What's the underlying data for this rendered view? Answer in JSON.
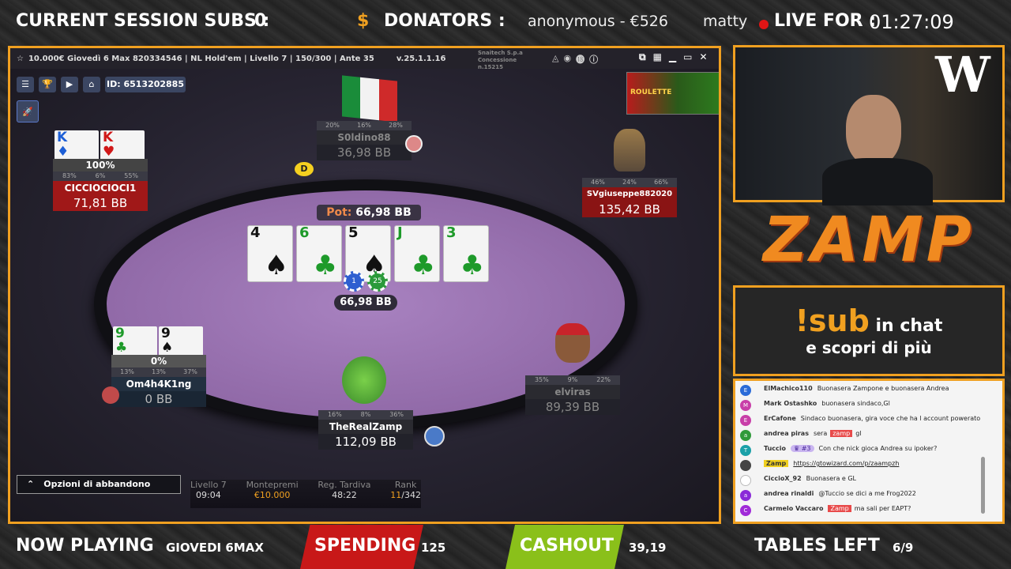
{
  "header": {
    "subs_label": "CURRENT SESSION SUBS :",
    "subs_value": "0",
    "dollar": "$",
    "donators_label": "DONATORS :",
    "donator1": "anonymous - €526",
    "donator2": "matty",
    "live_label": "LIVE FOR :",
    "live_time": "01:27:09"
  },
  "client": {
    "title": "10.000€ Giovedì 6 Max 820334546 | NL Hold'em | Livello 7 | 150/300 | Ante 35",
    "version": "v.25.1.1.16",
    "vendor1": "Snaitech S.p.a",
    "vendor2": "Concessione n.15215",
    "table_id": "ID: 6513202885",
    "pot_label": "Pot:",
    "pot_value": "66,98 BB",
    "center_pot": "66,98 BB",
    "dealer": "D",
    "leave_label": "Opzioni di abbandono",
    "banner": "ROULETTE"
  },
  "board": [
    {
      "r": "4",
      "s": "♠",
      "c": "#111"
    },
    {
      "r": "6",
      "s": "♣",
      "c": "#1e9a2a"
    },
    {
      "r": "5",
      "s": "♠",
      "c": "#111"
    },
    {
      "r": "J",
      "s": "♣",
      "c": "#1e9a2a"
    },
    {
      "r": "3",
      "s": "♣",
      "c": "#1e9a2a"
    }
  ],
  "chips": {
    "a": "1",
    "b": "25"
  },
  "seats": {
    "s1": {
      "name": "S0ldino88",
      "bb": "36,98 BB",
      "stats": [
        "20%",
        "16%",
        "28%"
      ]
    },
    "s2": {
      "name": "SVgiuseppe882020",
      "bb": "135,42 BB",
      "stats": [
        "46%",
        "24%",
        "66%"
      ]
    },
    "s3": {
      "name": "CICCIOCIOCI1",
      "bb": "71,81 BB",
      "stats": [
        "83%",
        "6%",
        "55%"
      ],
      "equity": "100%",
      "cards": [
        {
          "r": "K",
          "s": "♦",
          "c": "#1d5fd6"
        },
        {
          "r": "K",
          "s": "♥",
          "c": "#d01818"
        }
      ]
    },
    "s4": {
      "name": "Om4h4K1ng",
      "bb": "0 BB",
      "stats": [
        "13%",
        "13%",
        "37%"
      ],
      "equity": "0%",
      "cards": [
        {
          "r": "9",
          "s": "♣",
          "c": "#1e9a2a"
        },
        {
          "r": "9",
          "s": "♠",
          "c": "#111"
        }
      ]
    },
    "s5": {
      "name": "TheRealZamp",
      "bb": "112,09 BB",
      "stats": [
        "16%",
        "8%",
        "36%"
      ]
    },
    "s6": {
      "name": "elviras",
      "bb": "89,39 BB",
      "stats": [
        "35%",
        "9%",
        "22%"
      ]
    }
  },
  "tourney": {
    "level_label": "Livello 7",
    "level_time": "09:04",
    "prize_label": "Montepremi",
    "prize": "€10.000",
    "late_label": "Reg. Tardiva",
    "late": "48:22",
    "rank_label": "Rank",
    "rank_cur": "11",
    "rank_tot": "/342"
  },
  "brand": {
    "logo": "W",
    "name": "ZAMP",
    "sub_cmd": "!sub",
    "sub_text": " in chat",
    "sub_line2": "e scopri di più"
  },
  "chat": [
    {
      "av": "E",
      "col": "#2a6bd8",
      "user": "ElMachico110",
      "msg": "Buonasera Zampone e buonasera Andrea"
    },
    {
      "av": "M",
      "col": "#c83ea8",
      "user": "Mark Ostashko",
      "msg": "buonasera sindaco,Gl"
    },
    {
      "av": "E",
      "col": "#c83ea8",
      "user": "ErCafone",
      "msg": "Sindaco buonasera, gira voce che ha l account powerato"
    },
    {
      "av": "a",
      "col": "#2f9a3a",
      "user": "andrea piras",
      "msg": "sera",
      "tag": "zamp",
      "msg2": "gl"
    },
    {
      "av": "T",
      "col": "#1aa0a8",
      "user": "Tuccio",
      "badge": "#3",
      "msg": "Con che nick gioca Andrea su ipoker?"
    },
    {
      "av": "",
      "col": "#444",
      "user": "Zamp",
      "link": "https://gtowizard.com/p/zaampzh"
    },
    {
      "av": "",
      "col": "#fff",
      "user": "CiccioX_92",
      "msg": "Buonasera e GL"
    },
    {
      "av": "a",
      "col": "#8a2ad8",
      "user": "andrea rinaldi",
      "msg": "@Tuccio se dici a me Frog2022"
    },
    {
      "av": "C",
      "col": "#a02ad8",
      "user": "Carmelo Vaccaro",
      "tag": "Zamp",
      "msg": "ma sali per EAPT?"
    }
  ],
  "footer": {
    "now_label": "NOW PLAYING",
    "now_value": "GIOVEDI 6MAX",
    "spend_label": "SPENDING",
    "spend_value": "125",
    "cash_label": "CASHOUT",
    "cash_value": "39,19",
    "tables_label": "TABLES LEFT",
    "tables_value": "6/9"
  }
}
